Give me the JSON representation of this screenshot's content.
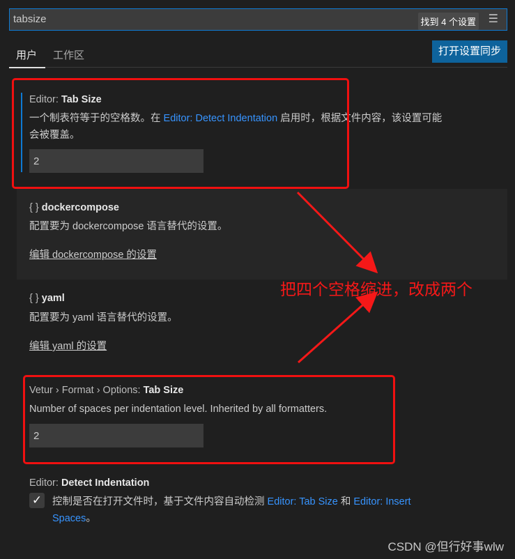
{
  "search": {
    "value": "tabsize",
    "result_count": "找到 4 个设置",
    "filter_icon": "clear-filter-icon"
  },
  "tabs": [
    {
      "label": "用户",
      "active": true
    },
    {
      "label": "工作区",
      "active": false
    }
  ],
  "sync_button": "打开设置同步",
  "settings": [
    {
      "prefix": "Editor: ",
      "name": "Tab Size",
      "desc_before": "一个制表符等于的空格数。在 ",
      "desc_link": "Editor: Detect Indentation",
      "desc_after": " 启用时，根据文件内容，该设置可能",
      "desc_line2": "会被覆盖。",
      "value": "2"
    },
    {
      "icon": "{ }",
      "name": "dockercompose",
      "desc": "配置要为 dockercompose 语言替代的设置。",
      "edit": "编辑 dockercompose 的设置"
    },
    {
      "icon": "{ }",
      "name": "yaml",
      "desc": "配置要为 yaml 语言替代的设置。",
      "edit": "编辑 yaml 的设置"
    },
    {
      "prefix": "Vetur › Format › Options: ",
      "name": "Tab Size",
      "desc": "Number of spaces per indentation level. Inherited by all formatters.",
      "value": "2"
    },
    {
      "prefix": "Editor: ",
      "name": "Detect Indentation",
      "checked": true,
      "desc_before": "控制是否在打开文件时，基于文件内容自动检测 ",
      "link1": "Editor: Tab Size",
      "mid": " 和 ",
      "link2": "Editor: Insert",
      "link2b": "Spaces",
      "desc_after": "。"
    }
  ],
  "annotation": "把四个空格缩进，改成两个",
  "annotation_color": "#f51818",
  "watermark": "CSDN @但行好事wlw"
}
